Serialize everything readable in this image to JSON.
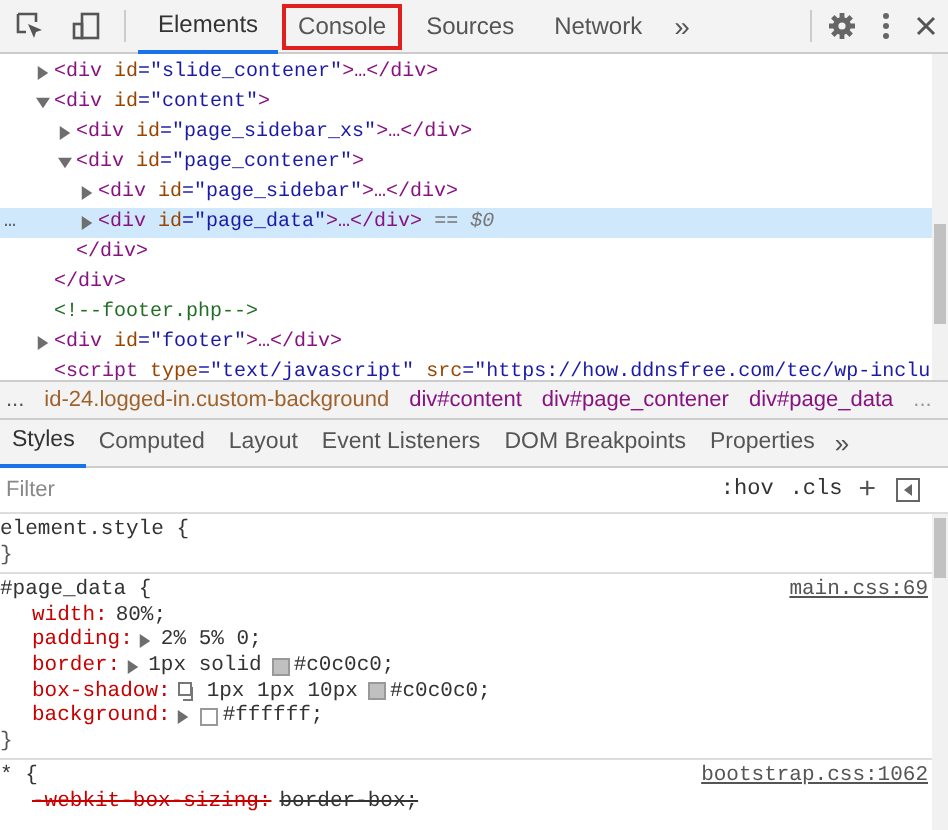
{
  "toolbar": {
    "tabs": [
      {
        "label": "Elements",
        "selected": true,
        "highlighted": false
      },
      {
        "label": "Console",
        "selected": false,
        "highlighted": true
      },
      {
        "label": "Sources",
        "selected": false,
        "highlighted": false
      },
      {
        "label": "Network",
        "selected": false,
        "highlighted": false
      }
    ],
    "more": "»"
  },
  "dom_tree": {
    "nodes": [
      {
        "kind": "element",
        "open": "<div",
        "attrs": [
          {
            "name": "id",
            "value": "=\"slide_contener\""
          }
        ],
        "end": ">…</div>",
        "expanded": false,
        "selected": false
      },
      {
        "kind": "element",
        "open": "<div",
        "attrs": [
          {
            "name": "id",
            "value": "=\"content\""
          }
        ],
        "end": ">",
        "expanded": true,
        "selected": false,
        "close": "</div>",
        "children": [
          {
            "kind": "element",
            "open": "<div",
            "attrs": [
              {
                "name": "id",
                "value": "=\"page_sidebar_xs\""
              }
            ],
            "end": ">…</div>",
            "expanded": false,
            "selected": false
          },
          {
            "kind": "element",
            "open": "<div",
            "attrs": [
              {
                "name": "id",
                "value": "=\"page_contener\""
              }
            ],
            "end": ">",
            "expanded": true,
            "selected": false,
            "close": "</div>",
            "children": [
              {
                "kind": "element",
                "open": "<div",
                "attrs": [
                  {
                    "name": "id",
                    "value": "=\"page_sidebar\""
                  }
                ],
                "end": ">…</div>",
                "expanded": false,
                "selected": false
              },
              {
                "kind": "element",
                "open": "<div",
                "attrs": [
                  {
                    "name": "id",
                    "value": "=\"page_data\""
                  }
                ],
                "end": ">…</div>",
                "expanded": false,
                "selected": true,
                "marker": "…",
                "suffix": "== $0"
              }
            ]
          }
        ]
      },
      {
        "kind": "comment",
        "text": "<!--footer.php-->"
      },
      {
        "kind": "element",
        "open": "<div",
        "attrs": [
          {
            "name": "id",
            "value": "=\"footer\""
          }
        ],
        "end": ">…</div>",
        "expanded": false,
        "selected": false
      },
      {
        "kind": "element",
        "open": "<script",
        "attrs": [
          {
            "name": "type",
            "value": "=\"text/javascript\""
          },
          {
            "name": "src",
            "value": "=\"https://how.ddnsfree.com/tec/wp-inclu"
          }
        ],
        "selected": false
      }
    ]
  },
  "breadcrumbs": {
    "lead": "...",
    "items": [
      {
        "text": "id-24.logged-in.custom-background",
        "color": "#a0622d"
      },
      {
        "text": "div#content",
        "color": "#881280"
      },
      {
        "text": "div#page_contener",
        "color": "#881280"
      },
      {
        "text": "div#page_data",
        "color": "#881280"
      }
    ],
    "trail": "..."
  },
  "styles_tabs": {
    "tabs": [
      {
        "label": "Styles",
        "selected": true
      },
      {
        "label": "Computed",
        "selected": false
      },
      {
        "label": "Layout",
        "selected": false
      },
      {
        "label": "Event Listeners",
        "selected": false
      },
      {
        "label": "DOM Breakpoints",
        "selected": false
      },
      {
        "label": "Properties",
        "selected": false
      }
    ],
    "more": "»"
  },
  "filter": {
    "placeholder": "Filter",
    "hov": ":hov",
    "cls": ".cls",
    "add": "+"
  },
  "rules": [
    {
      "selector": "element.style",
      "open": "{",
      "close": "}"
    },
    {
      "selector": "#page_data",
      "open": "{",
      "close": "}",
      "source": "main.css:69",
      "properties": [
        {
          "name": "width:",
          "expandable": false,
          "value": "80%;",
          "struck": false
        },
        {
          "name": "padding:",
          "expandable": true,
          "value": "2% 5% 0;",
          "struck": false
        },
        {
          "name": "border:",
          "expandable": true,
          "value": "1px solid",
          "color": "#c0c0c0",
          "after": "#c0c0c0;",
          "struck": false
        },
        {
          "name": "box-shadow:",
          "expandable": false,
          "shadow_editor": true,
          "value": "1px 1px 10px",
          "color": "#c0c0c0",
          "after": "#c0c0c0;",
          "struck": false
        },
        {
          "name": "background:",
          "expandable": true,
          "color": "#ffffff",
          "after": "#ffffff;",
          "struck": false
        }
      ]
    },
    {
      "selector": "*",
      "open": "{",
      "source": "bootstrap.css:1062",
      "properties": [
        {
          "name": "-webkit-box-sizing:",
          "expandable": false,
          "value": "border-box;",
          "struck": true
        }
      ]
    }
  ]
}
